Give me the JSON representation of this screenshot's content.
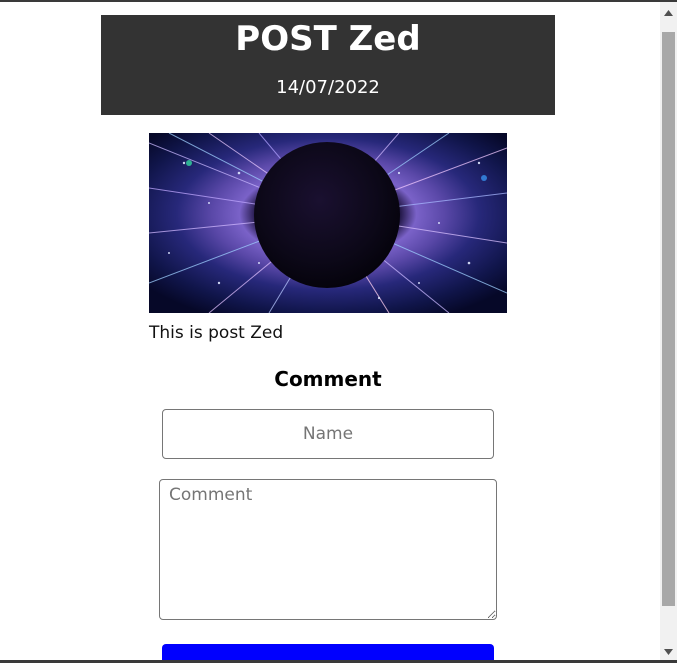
{
  "post": {
    "title": "POST Zed",
    "date": "14/07/2022",
    "body": "This is post Zed",
    "image_alt": "cosmic-eye-image"
  },
  "comment_form": {
    "heading": "Comment",
    "name_placeholder": "Name",
    "name_value": "",
    "comment_placeholder": "Comment",
    "comment_value": "",
    "submit_label": ""
  },
  "colors": {
    "header_bg": "#333333",
    "submit_bg": "#0000ff"
  },
  "scrollbar": {
    "up_icon": "scroll-up-arrow-icon",
    "down_icon": "scroll-down-arrow-icon"
  }
}
